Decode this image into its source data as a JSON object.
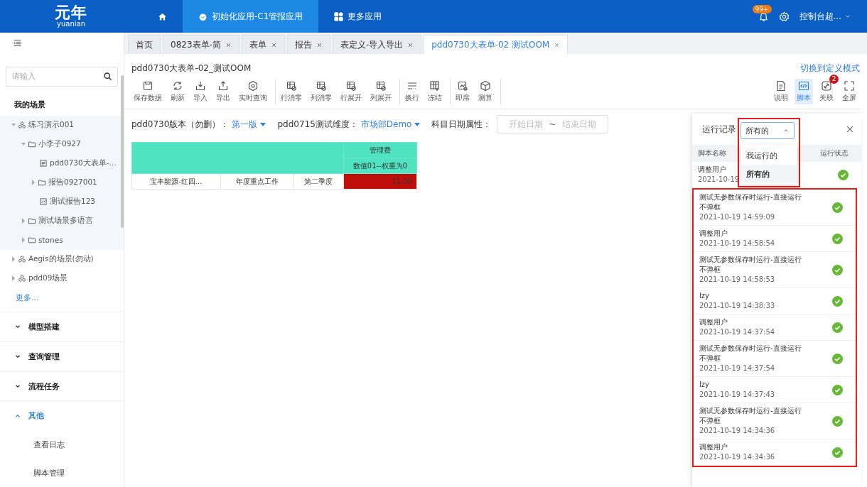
{
  "header": {
    "logo": "元年",
    "logo_sub": "yuanian",
    "nav": [
      {
        "kind": "home",
        "selected": false
      },
      {
        "kind": "app",
        "label": "初始化应用-C1管报应用",
        "selected": true
      },
      {
        "kind": "more",
        "label": "更多应用",
        "selected": false
      }
    ],
    "notification_badge": "99+",
    "user": "控制台超..."
  },
  "sidebar": {
    "search": {
      "placeholder": "请输入"
    },
    "section_title": "我的场景",
    "tree": [
      {
        "label": "练习演示001",
        "kind": "scene",
        "expanded": true,
        "children": [
          {
            "label": "小李子0927",
            "kind": "folder",
            "expanded": true,
            "children": [
              {
                "label": "pdd0730大表单-...",
                "kind": "form"
              },
              {
                "label": "报告0927001",
                "kind": "folder",
                "expanded": false
              },
              {
                "label": "测试报告123",
                "kind": "report"
              }
            ]
          },
          {
            "label": "测试场景多语言",
            "kind": "folder",
            "expanded": false
          },
          {
            "label": "stones",
            "kind": "folder",
            "expanded": false
          }
        ]
      },
      {
        "label": "Aegis的场景(勿动)",
        "kind": "scene",
        "expanded": false
      },
      {
        "label": "pdd09场景",
        "kind": "scene",
        "expanded": false
      }
    ],
    "more_link": "更多...",
    "sections": [
      {
        "label": "模型搭建",
        "expanded": false
      },
      {
        "label": "查询管理",
        "expanded": false
      },
      {
        "label": "流程任务",
        "expanded": false
      },
      {
        "label": "其他",
        "expanded": true,
        "children": [
          "查看日志",
          "脚本管理"
        ]
      }
    ]
  },
  "tabs": [
    {
      "label": "首页",
      "closable": false,
      "selected": false
    },
    {
      "label": "0823表单-简",
      "closable": true,
      "selected": false
    },
    {
      "label": "表单",
      "closable": true,
      "selected": false
    },
    {
      "label": "报告",
      "closable": true,
      "selected": false
    },
    {
      "label": "表定义-导入导出",
      "closable": true,
      "selected": false
    },
    {
      "label": "pdd0730大表单-02 测试OOM",
      "closable": true,
      "selected": true
    }
  ],
  "form": {
    "title": "pdd0730大表单-02_测试OOM",
    "mode_link": "切换到定义模式",
    "toolbar_groups": [
      [
        "保存数据",
        "刷新",
        "导入",
        "导出",
        "实时查询"
      ],
      [
        "行消零",
        "列消零",
        "行展开",
        "列展开"
      ],
      [
        "换行",
        "冻结"
      ],
      [
        "即席",
        "测算"
      ]
    ],
    "right_tools": [
      {
        "label": "说明",
        "selected": false
      },
      {
        "label": "脚本",
        "selected": true
      },
      {
        "label": "关联",
        "selected": false,
        "badge": "2"
      },
      {
        "label": "全屏",
        "selected": false
      }
    ],
    "filters": [
      {
        "kind": "select",
        "label": "pdd0730版本（勿删）：",
        "value": "第一版"
      },
      {
        "kind": "select",
        "label": "pdd0715测试维度：",
        "value": "市场部Demo"
      },
      {
        "kind": "daterange",
        "label": "科目日期属性：",
        "start_placeholder": "开始日期",
        "separator": "~",
        "end_placeholder": "结束日期"
      }
    ],
    "table": {
      "header_top": "管理费",
      "header_sub": "数值01--权重为0",
      "rows": [
        {
          "cells": [
            "宝丰能源-红四...",
            "年度重点工作",
            "第二季度"
          ],
          "value": "11.00",
          "highlight": true
        }
      ]
    }
  },
  "run_panel": {
    "title": "运行记录",
    "filter_value": "所有的",
    "filter_open": true,
    "options": [
      {
        "label": "我运行的",
        "selected": false
      },
      {
        "label": "所有的",
        "selected": true
      }
    ],
    "columns": [
      "脚本名称",
      "运行状态"
    ],
    "rows": [
      {
        "name": "调整用户",
        "time": "2021-10-19",
        "success": true,
        "highlighted": false
      },
      {
        "name": "测试无参数保存时运行-直接运行不弹框",
        "time": "2021-10-19 14:59:09",
        "success": true,
        "highlighted": true
      },
      {
        "name": "调整用户",
        "time": "2021-10-19 14:58:54",
        "success": true,
        "highlighted": true
      },
      {
        "name": "测试无参数保存时运行-直接运行不弹框",
        "time": "2021-10-19 14:58:53",
        "success": true,
        "highlighted": true
      },
      {
        "name": "lzy",
        "time": "2021-10-19 14:38:33",
        "success": true,
        "highlighted": true
      },
      {
        "name": "调整用户",
        "time": "2021-10-19 14:37:54",
        "success": true,
        "highlighted": true
      },
      {
        "name": "测试无参数保存时运行-直接运行不弹框",
        "time": "2021-10-19 14:37:54",
        "success": true,
        "highlighted": true
      },
      {
        "name": "lzy",
        "time": "2021-10-19 14:37:43",
        "success": true,
        "highlighted": true
      },
      {
        "name": "测试无参数保存时运行-直接运行不弹框",
        "time": "2021-10-19 14:34:36",
        "success": true,
        "highlighted": true
      },
      {
        "name": "调整用户",
        "time": "2021-10-19 14:34:36",
        "success": true,
        "highlighted": true
      }
    ]
  }
}
